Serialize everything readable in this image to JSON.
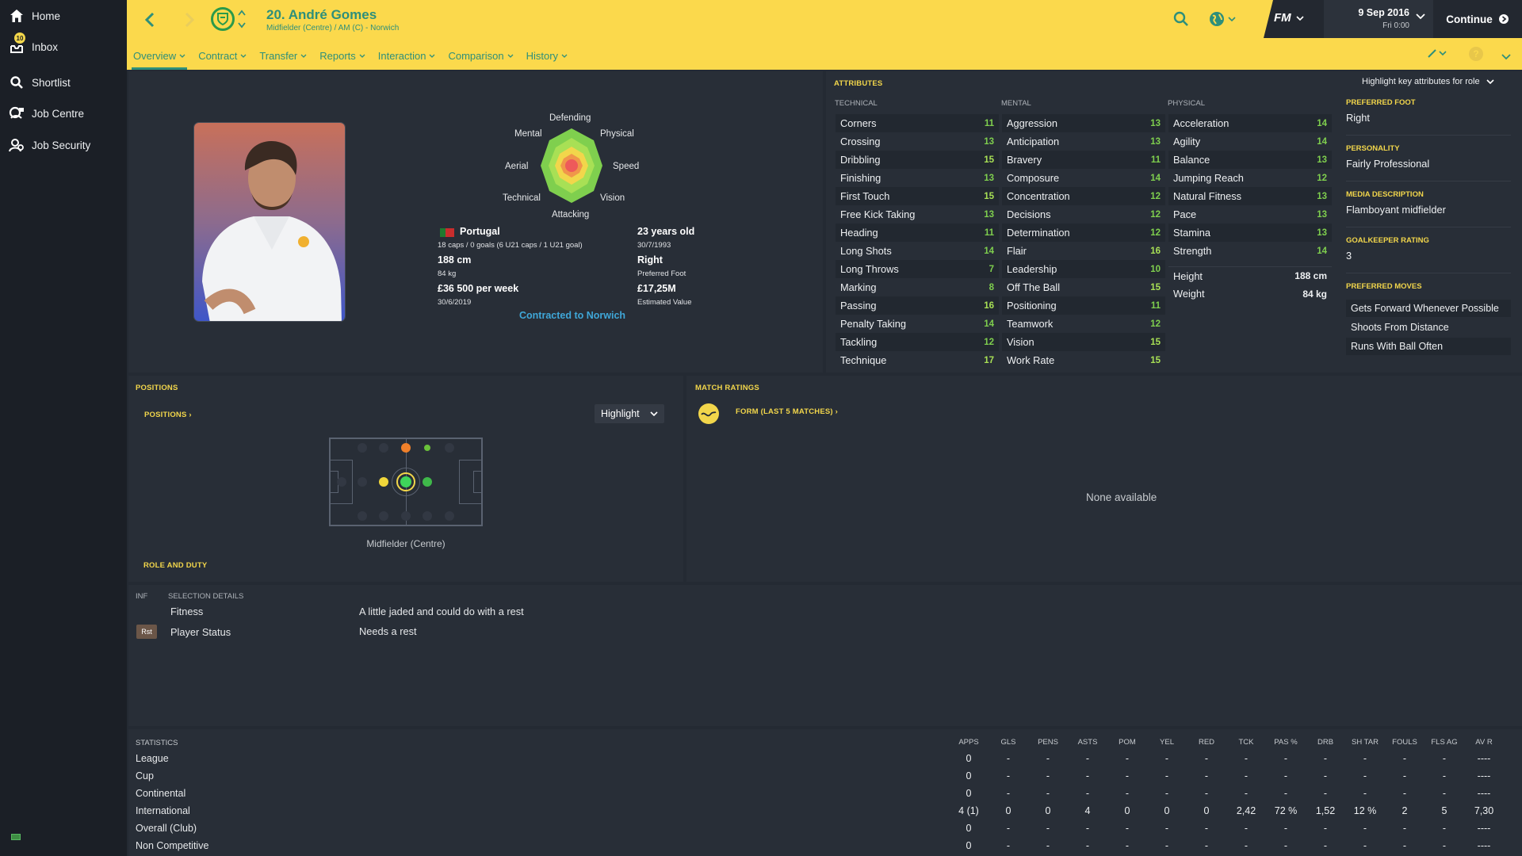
{
  "sidebar": {
    "items": [
      {
        "label": "Home",
        "icon": "home-icon"
      },
      {
        "label": "Inbox",
        "icon": "inbox-icon",
        "badge": "10"
      },
      {
        "label": "Shortlist",
        "icon": "search-icon"
      },
      {
        "label": "Job Centre",
        "icon": "job-centre-icon"
      },
      {
        "label": "Job Security",
        "icon": "job-security-icon"
      }
    ]
  },
  "header": {
    "player_name": "20. André Gomes",
    "player_subtitle": "Midfielder (Centre) / AM (C) - Norwich",
    "logo": "FM",
    "date": "9 Sep 2016",
    "time": "Fri 0:00",
    "continue_label": "Continue"
  },
  "tabs": [
    {
      "label": "Overview",
      "active": true
    },
    {
      "label": "Contract"
    },
    {
      "label": "Transfer"
    },
    {
      "label": "Reports"
    },
    {
      "label": "Interaction"
    },
    {
      "label": "Comparison"
    },
    {
      "label": "History"
    }
  ],
  "overview": {
    "radar_labels": {
      "defending": "Defending",
      "mental": "Mental",
      "physical": "Physical",
      "aerial": "Aerial",
      "speed": "Speed",
      "technical": "Technical",
      "vision": "Vision",
      "attacking": "Attacking"
    },
    "nationality": "Portugal",
    "caps": "18 caps / 0 goals (6 U21 caps / 1 U21 goal)",
    "height": "188 cm",
    "weight": "84 kg",
    "wage": "£36 500 per week",
    "contract_end": "30/6/2019",
    "age": "23 years old",
    "dob": "30/7/1993",
    "foot": "Right",
    "foot_label": "Preferred Foot",
    "value": "£17,25M",
    "value_label": "Estimated Value",
    "contract_status": "Contracted to Norwich"
  },
  "attributes": {
    "title": "ATTRIBUTES",
    "highlight_label": "Highlight key attributes for role",
    "technical_head": "TECHNICAL",
    "mental_head": "MENTAL",
    "physical_head": "PHYSICAL",
    "technical": [
      {
        "name": "Corners",
        "value": "11"
      },
      {
        "name": "Crossing",
        "value": "13"
      },
      {
        "name": "Dribbling",
        "value": "15"
      },
      {
        "name": "Finishing",
        "value": "13"
      },
      {
        "name": "First Touch",
        "value": "15"
      },
      {
        "name": "Free Kick Taking",
        "value": "13"
      },
      {
        "name": "Heading",
        "value": "11"
      },
      {
        "name": "Long Shots",
        "value": "14"
      },
      {
        "name": "Long Throws",
        "value": "7"
      },
      {
        "name": "Marking",
        "value": "8"
      },
      {
        "name": "Passing",
        "value": "16"
      },
      {
        "name": "Penalty Taking",
        "value": "14"
      },
      {
        "name": "Tackling",
        "value": "12"
      },
      {
        "name": "Technique",
        "value": "17"
      }
    ],
    "mental": [
      {
        "name": "Aggression",
        "value": "13"
      },
      {
        "name": "Anticipation",
        "value": "13"
      },
      {
        "name": "Bravery",
        "value": "11"
      },
      {
        "name": "Composure",
        "value": "14"
      },
      {
        "name": "Concentration",
        "value": "12"
      },
      {
        "name": "Decisions",
        "value": "12"
      },
      {
        "name": "Determination",
        "value": "12"
      },
      {
        "name": "Flair",
        "value": "16"
      },
      {
        "name": "Leadership",
        "value": "10"
      },
      {
        "name": "Off The Ball",
        "value": "15"
      },
      {
        "name": "Positioning",
        "value": "11"
      },
      {
        "name": "Teamwork",
        "value": "12"
      },
      {
        "name": "Vision",
        "value": "15"
      },
      {
        "name": "Work Rate",
        "value": "15"
      }
    ],
    "physical": [
      {
        "name": "Acceleration",
        "value": "14"
      },
      {
        "name": "Agility",
        "value": "14"
      },
      {
        "name": "Balance",
        "value": "13"
      },
      {
        "name": "Jumping Reach",
        "value": "12"
      },
      {
        "name": "Natural Fitness",
        "value": "13"
      },
      {
        "name": "Pace",
        "value": "13"
      },
      {
        "name": "Stamina",
        "value": "13"
      },
      {
        "name": "Strength",
        "value": "14"
      }
    ],
    "height_label": "Height",
    "height_value": "188 cm",
    "weight_label": "Weight",
    "weight_value": "84 kg"
  },
  "side_info": {
    "preferred_foot_label": "PREFERRED FOOT",
    "preferred_foot": "Right",
    "personality_label": "PERSONALITY",
    "personality": "Fairly Professional",
    "media_label": "MEDIA DESCRIPTION",
    "media": "Flamboyant midfielder",
    "gk_label": "GOALKEEPER RATING",
    "gk_rating": "3",
    "moves_label": "PREFERRED MOVES",
    "moves": [
      "Gets Forward Whenever Possible",
      "Shoots From Distance",
      "Runs With Ball Often"
    ]
  },
  "positions": {
    "title": "POSITIONS",
    "link": "POSITIONS",
    "dropdown": "Highlight",
    "position_label": "Midfielder (Centre)",
    "role_label": "ROLE AND DUTY"
  },
  "match_ratings": {
    "title": "MATCH RATINGS",
    "form_link": "FORM (LAST 5 MATCHES)",
    "empty": "None available"
  },
  "selection": {
    "inf_head": "INF",
    "details_head": "SELECTION DETAILS",
    "rows": [
      {
        "badge": "",
        "label": "Fitness",
        "value": "A little jaded and could do with a rest"
      },
      {
        "badge": "Rst",
        "label": "Player Status",
        "value": "Needs a rest"
      }
    ]
  },
  "statistics": {
    "title": "STATISTICS",
    "columns": [
      "APPS",
      "GLS",
      "PENS",
      "ASTS",
      "POM",
      "YEL",
      "RED",
      "TCK",
      "PAS %",
      "DRB",
      "SH TAR",
      "FOULS",
      "FLS AG",
      "AV R"
    ],
    "rows": [
      {
        "label": "League",
        "values": [
          "0",
          "-",
          "-",
          "-",
          "-",
          "-",
          "-",
          "-",
          "-",
          "-",
          "-",
          "-",
          "-",
          "----"
        ]
      },
      {
        "label": "Cup",
        "values": [
          "0",
          "-",
          "-",
          "-",
          "-",
          "-",
          "-",
          "-",
          "-",
          "-",
          "-",
          "-",
          "-",
          "----"
        ]
      },
      {
        "label": "Continental",
        "values": [
          "0",
          "-",
          "-",
          "-",
          "-",
          "-",
          "-",
          "-",
          "-",
          "-",
          "-",
          "-",
          "-",
          "----"
        ]
      },
      {
        "label": "International",
        "values": [
          "4 (1)",
          "0",
          "0",
          "4",
          "0",
          "0",
          "0",
          "2,42",
          "72 %",
          "1,52",
          "12 %",
          "2",
          "5",
          "7,30"
        ]
      },
      {
        "label": "Overall (Club)",
        "values": [
          "0",
          "-",
          "-",
          "-",
          "-",
          "-",
          "-",
          "-",
          "-",
          "-",
          "-",
          "-",
          "-",
          "----"
        ]
      },
      {
        "label": "Non Competitive",
        "values": [
          "0",
          "-",
          "-",
          "-",
          "-",
          "-",
          "-",
          "-",
          "-",
          "-",
          "-",
          "-",
          "-",
          "----"
        ]
      }
    ]
  },
  "colors": {
    "accent": "#fbd94c",
    "teal": "#2e8f7a",
    "good": "#7fcf4e",
    "link": "#3fa7d8"
  }
}
